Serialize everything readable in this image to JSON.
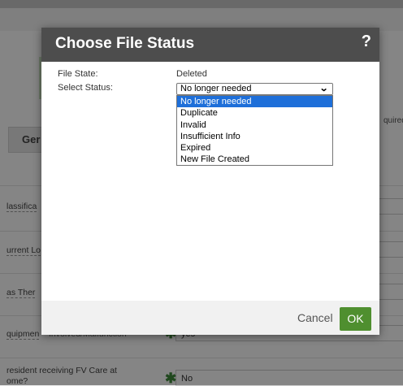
{
  "background": {
    "tab_label": "Ger",
    "right_cut_text": "quired",
    "labels": [
      "lassifica",
      "urrent Lo",
      "as Ther",
      "quipmen",
      "resident receiving FV Care at",
      "ome?"
    ],
    "partial_value_text": "Involved/Malfunction",
    "field_yes": "yes",
    "field_no": "No",
    "required_marker": "✱"
  },
  "dialog": {
    "title": "Choose File Status",
    "help_icon": "?",
    "file_state_label": "File State:",
    "file_state_value": "Deleted",
    "select_status_label": "Select Status:",
    "select": {
      "value": "No longer needed",
      "chevron": "⌄",
      "options": [
        "No longer needed",
        "Duplicate",
        "Invalid",
        "Insufficient Info",
        "Expired",
        "New File Created"
      ]
    },
    "cancel_label": "Cancel",
    "ok_label": "OK"
  },
  "colors": {
    "header_bg": "#4d4d4d",
    "ok_button": "#4f8f2f",
    "selected_option": "#1e6fd9",
    "required_star": "#3f8a3a"
  }
}
